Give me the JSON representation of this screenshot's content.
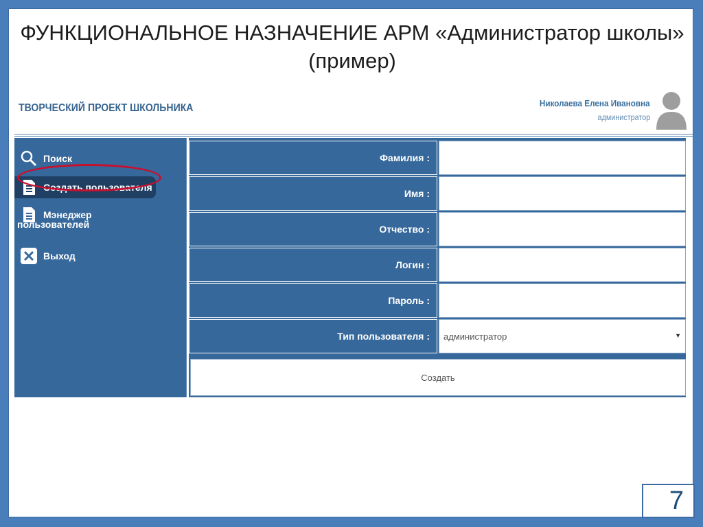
{
  "slide": {
    "title_line1": "ФУНКЦИОНАЛЬНОЕ НАЗНАЧЕНИЕ АРМ «Администратор школы»",
    "title_line2": "(пример)",
    "page_number": "7"
  },
  "app": {
    "title": "ТВОРЧЕСКИЙ ПРОЕКТ ШКОЛЬНИКА",
    "user_name": "Николаева Елена Ивановна",
    "user_role": "администратор"
  },
  "sidebar": {
    "items": [
      {
        "label": "Поиск",
        "icon": "search-icon"
      },
      {
        "label": "Создать пользователя",
        "icon": "document-icon",
        "active": true
      },
      {
        "label": "Мэнеджер",
        "icon": "document-icon"
      },
      {
        "label": "пользователей"
      },
      {
        "label": "Выход",
        "icon": "close-icon"
      }
    ]
  },
  "form": {
    "fields": [
      {
        "label": "Фамилия :",
        "value": ""
      },
      {
        "label": "Имя :",
        "value": ""
      },
      {
        "label": "Отчество :",
        "value": ""
      },
      {
        "label": "Логин :",
        "value": ""
      },
      {
        "label": "Пароль :",
        "value": ""
      },
      {
        "label": "Тип пользователя :",
        "value": "администратор"
      }
    ],
    "submit_label": "Создать"
  },
  "colors": {
    "frame": "#4a7ebb",
    "panel": "#36689b",
    "active": "#1f3f63",
    "highlight": "#c8102e"
  }
}
